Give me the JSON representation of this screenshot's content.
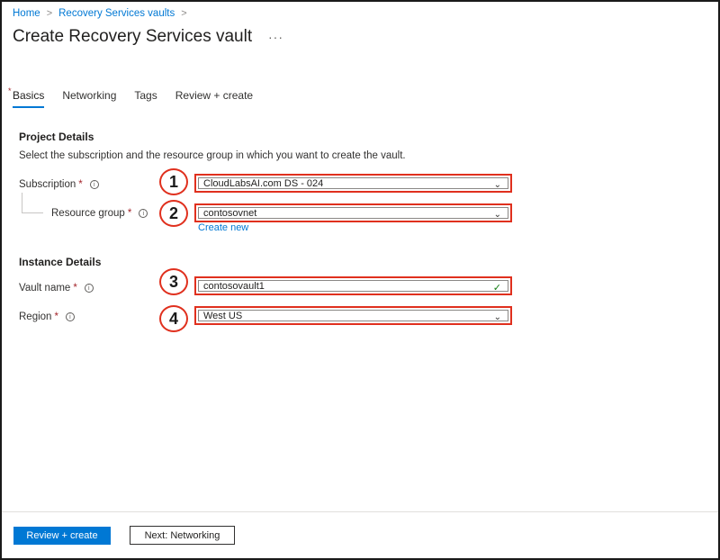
{
  "breadcrumb": {
    "home": "Home",
    "vaults": "Recovery Services vaults",
    "separator": ">"
  },
  "page": {
    "title": "Create Recovery Services vault",
    "more": "···"
  },
  "tabs": [
    {
      "label": "Basics",
      "active": true,
      "required_marker": "*"
    },
    {
      "label": "Networking"
    },
    {
      "label": "Tags"
    },
    {
      "label": "Review + create"
    }
  ],
  "project": {
    "title": "Project Details",
    "description": "Select the subscription and the resource group in which you want to create the vault."
  },
  "fields": {
    "subscription": {
      "label": "Subscription",
      "required": "*",
      "value": "CloudLabsAI.com DS - 024",
      "badge": "1"
    },
    "resource_group": {
      "label": "Resource group",
      "required": "*",
      "value": "contosovnet",
      "badge": "2",
      "create_new": "Create new"
    },
    "vault_name": {
      "label": "Vault name",
      "required": "*",
      "value": "contosovault1",
      "badge": "3"
    },
    "region": {
      "label": "Region",
      "required": "*",
      "value": "West US",
      "badge": "4"
    }
  },
  "instance": {
    "title": "Instance Details"
  },
  "footer": {
    "review_create": "Review + create",
    "next": "Next: Networking"
  },
  "icons": {
    "info": "i",
    "chevron": "⌄",
    "check": "✓"
  },
  "colors": {
    "accent": "#0078d4",
    "highlight": "#e0301e",
    "required": "#a4262c",
    "valid": "#107c10"
  }
}
